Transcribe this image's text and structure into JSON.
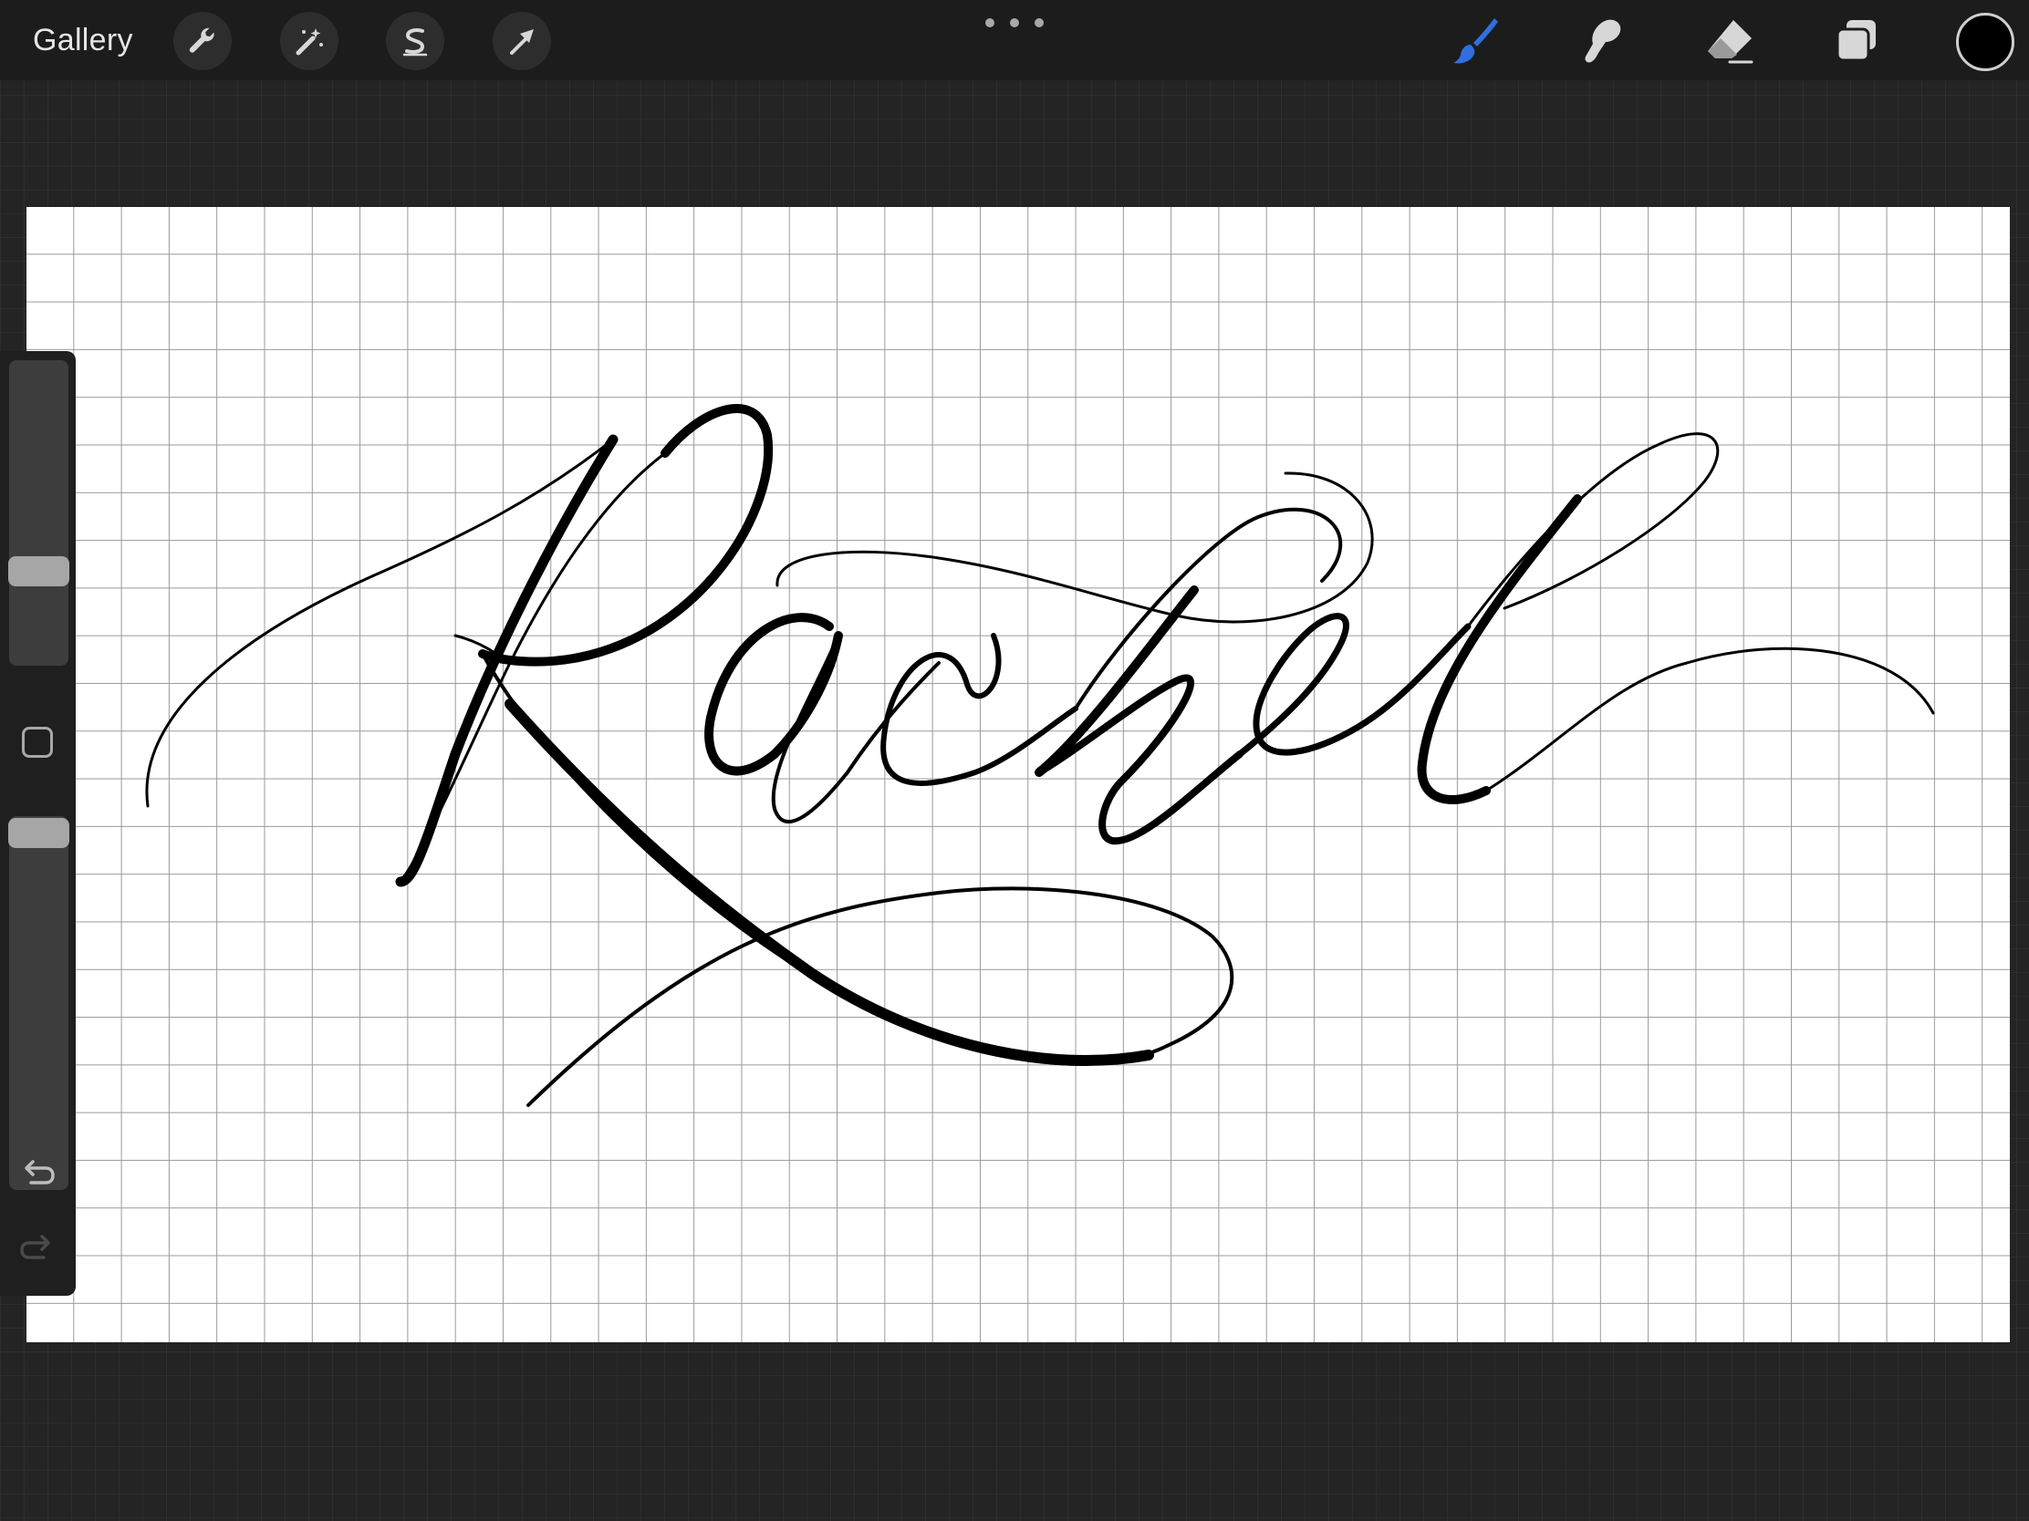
{
  "toolbar": {
    "gallery_label": "Gallery",
    "left_tools": [
      {
        "name": "actions",
        "icon": "wrench-icon"
      },
      {
        "name": "adjustments",
        "icon": "magic-wand-icon"
      },
      {
        "name": "selection",
        "icon": "selection-s-icon"
      },
      {
        "name": "transform",
        "icon": "arrow-cursor-icon"
      }
    ],
    "more_icon": "ellipsis-icon",
    "right_tools": [
      {
        "name": "brush",
        "icon": "brush-icon",
        "active": true
      },
      {
        "name": "smudge",
        "icon": "smudge-finger-icon",
        "active": false
      },
      {
        "name": "eraser",
        "icon": "eraser-icon",
        "active": false
      },
      {
        "name": "layers",
        "icon": "layers-icon",
        "active": false
      }
    ],
    "active_color": "#000000",
    "accent_color": "#2f6fe0"
  },
  "sidebar": {
    "brush_size_level": 0.26,
    "opacity_level": 0.04,
    "modify_button_icon": "square-icon",
    "undo_icon": "undo-arrow-icon",
    "redo_icon": "redo-arrow-icon",
    "redo_enabled": false
  },
  "canvas": {
    "background": "#ffffff",
    "grid_visible": true,
    "artwork_text": "Rachel",
    "artwork_style": "pointed-pen calligraphy with flourishes"
  }
}
